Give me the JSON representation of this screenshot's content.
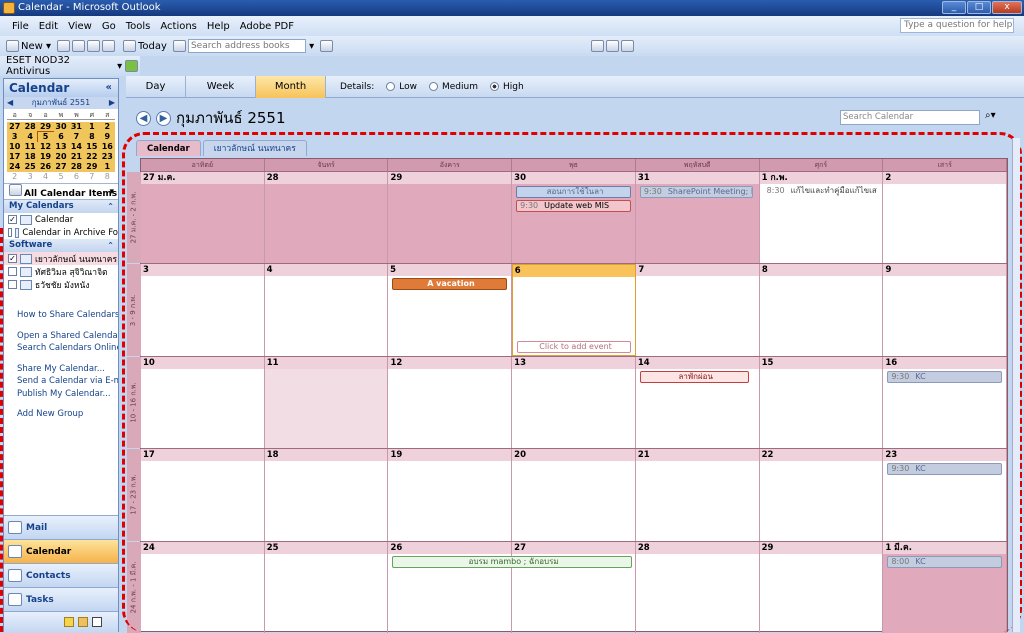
{
  "window": {
    "title": "Calendar - Microsoft Outlook",
    "min": "_",
    "max": "□",
    "close": "x"
  },
  "menu": [
    "File",
    "Edit",
    "View",
    "Go",
    "Tools",
    "Actions",
    "Help",
    "Adobe PDF"
  ],
  "help_placeholder": "Type a question for help",
  "toolbar": {
    "new": "New",
    "today": "Today",
    "search_placeholder": "Search address books"
  },
  "toolbar2": {
    "eset": "ESET NOD32 Antivirus"
  },
  "nav": {
    "title": "Calendar",
    "collapse": "«",
    "minical": {
      "month": "กุมภาพันธ์ 2551",
      "prev": "◀",
      "next": "▶",
      "dow": [
        "อ",
        "จ",
        "อ",
        "พ",
        "พ",
        "ศ",
        "ส"
      ],
      "days": [
        "27",
        "28",
        "29",
        "30",
        "31",
        "1",
        "2",
        "3",
        "4",
        "5",
        "6",
        "7",
        "8",
        "9",
        "10",
        "11",
        "12",
        "13",
        "14",
        "15",
        "16",
        "17",
        "18",
        "19",
        "20",
        "21",
        "22",
        "23",
        "24",
        "25",
        "26",
        "27",
        "28",
        "29",
        "1",
        "2",
        "3",
        "4",
        "5",
        "6",
        "7",
        "8"
      ]
    },
    "all_items": "All Calendar Items",
    "my_calendars": "My Calendars",
    "my_cal_items": [
      "Calendar",
      "Calendar in Archive Fo"
    ],
    "software": "Software",
    "software_items": [
      "เยาวลักษณ์ นนทนาคร",
      "ทัศธิวิมล สุจิวิณาจิต",
      "ธวัชชัย มังหนัง"
    ],
    "links": [
      "How to Share Calendars",
      "Open a Shared Calendar...",
      "Search Calendars Online",
      "Share My Calendar...",
      "Send a Calendar via E-mail...",
      "Publish My Calendar...",
      "Add New Group"
    ],
    "buttons": [
      "Mail",
      "Calendar",
      "Contacts",
      "Tasks"
    ]
  },
  "view_tabs": [
    "Day",
    "Week",
    "Month"
  ],
  "details": {
    "label": "Details:",
    "options": [
      "Low",
      "Medium",
      "High"
    ]
  },
  "date_header": "กุมภาพันธ์ 2551",
  "search_calendar": "Search Calendar",
  "cal_tabs": [
    "Calendar",
    "เยาวลักษณ์ นนทนาคร"
  ],
  "dow": [
    "อาทิตย์",
    "จันทร์",
    "อังคาร",
    "พุธ",
    "พฤหัสบดี",
    "ศุกร์",
    "เสาร์"
  ],
  "weeks": [
    {
      "label": "27 ม.ค. - 2 ก.พ.",
      "days": [
        "27 ม.ค.",
        "28",
        "29",
        "30",
        "31",
        "1 ก.พ.",
        "2"
      ]
    },
    {
      "label": "3 - 9 ก.พ.",
      "days": [
        "3",
        "4",
        "5",
        "6",
        "7",
        "8",
        "9"
      ]
    },
    {
      "label": "10 - 16 ก.พ.",
      "days": [
        "10",
        "11",
        "12",
        "13",
        "14",
        "15",
        "16"
      ]
    },
    {
      "label": "17 - 23 ก.พ.",
      "days": [
        "17",
        "18",
        "19",
        "20",
        "21",
        "22",
        "23"
      ]
    },
    {
      "label": "24 ก.พ. - 1 มี.ค.",
      "days": [
        "24",
        "25",
        "26",
        "27",
        "28",
        "29",
        "1 มี.ค."
      ]
    }
  ],
  "events": {
    "w1_wed_a": "สอนการใช้ในลา",
    "w1_wed_b_time": "9:30",
    "w1_wed_b": "Update web MIS",
    "w1_thu_time": "9:30",
    "w1_thu": "SharePoint Meeting; M",
    "w1_fri_time": "8:30",
    "w1_fri": "แก้ไขและทำคู่มือแก้ไขเส",
    "w2_vacation": "A vacation",
    "w2_click": "Click to add event",
    "w3_thu": "ลาพักผ่อน",
    "w3_sat_time": "9:30",
    "w3_sat": "KC",
    "w4_sat_time": "9:30",
    "w4_sat": "KC",
    "w5_train": "อบรม mambo ; ฉักอบรม",
    "w5_sat_time": "8:00",
    "w5_sat": "KC"
  }
}
